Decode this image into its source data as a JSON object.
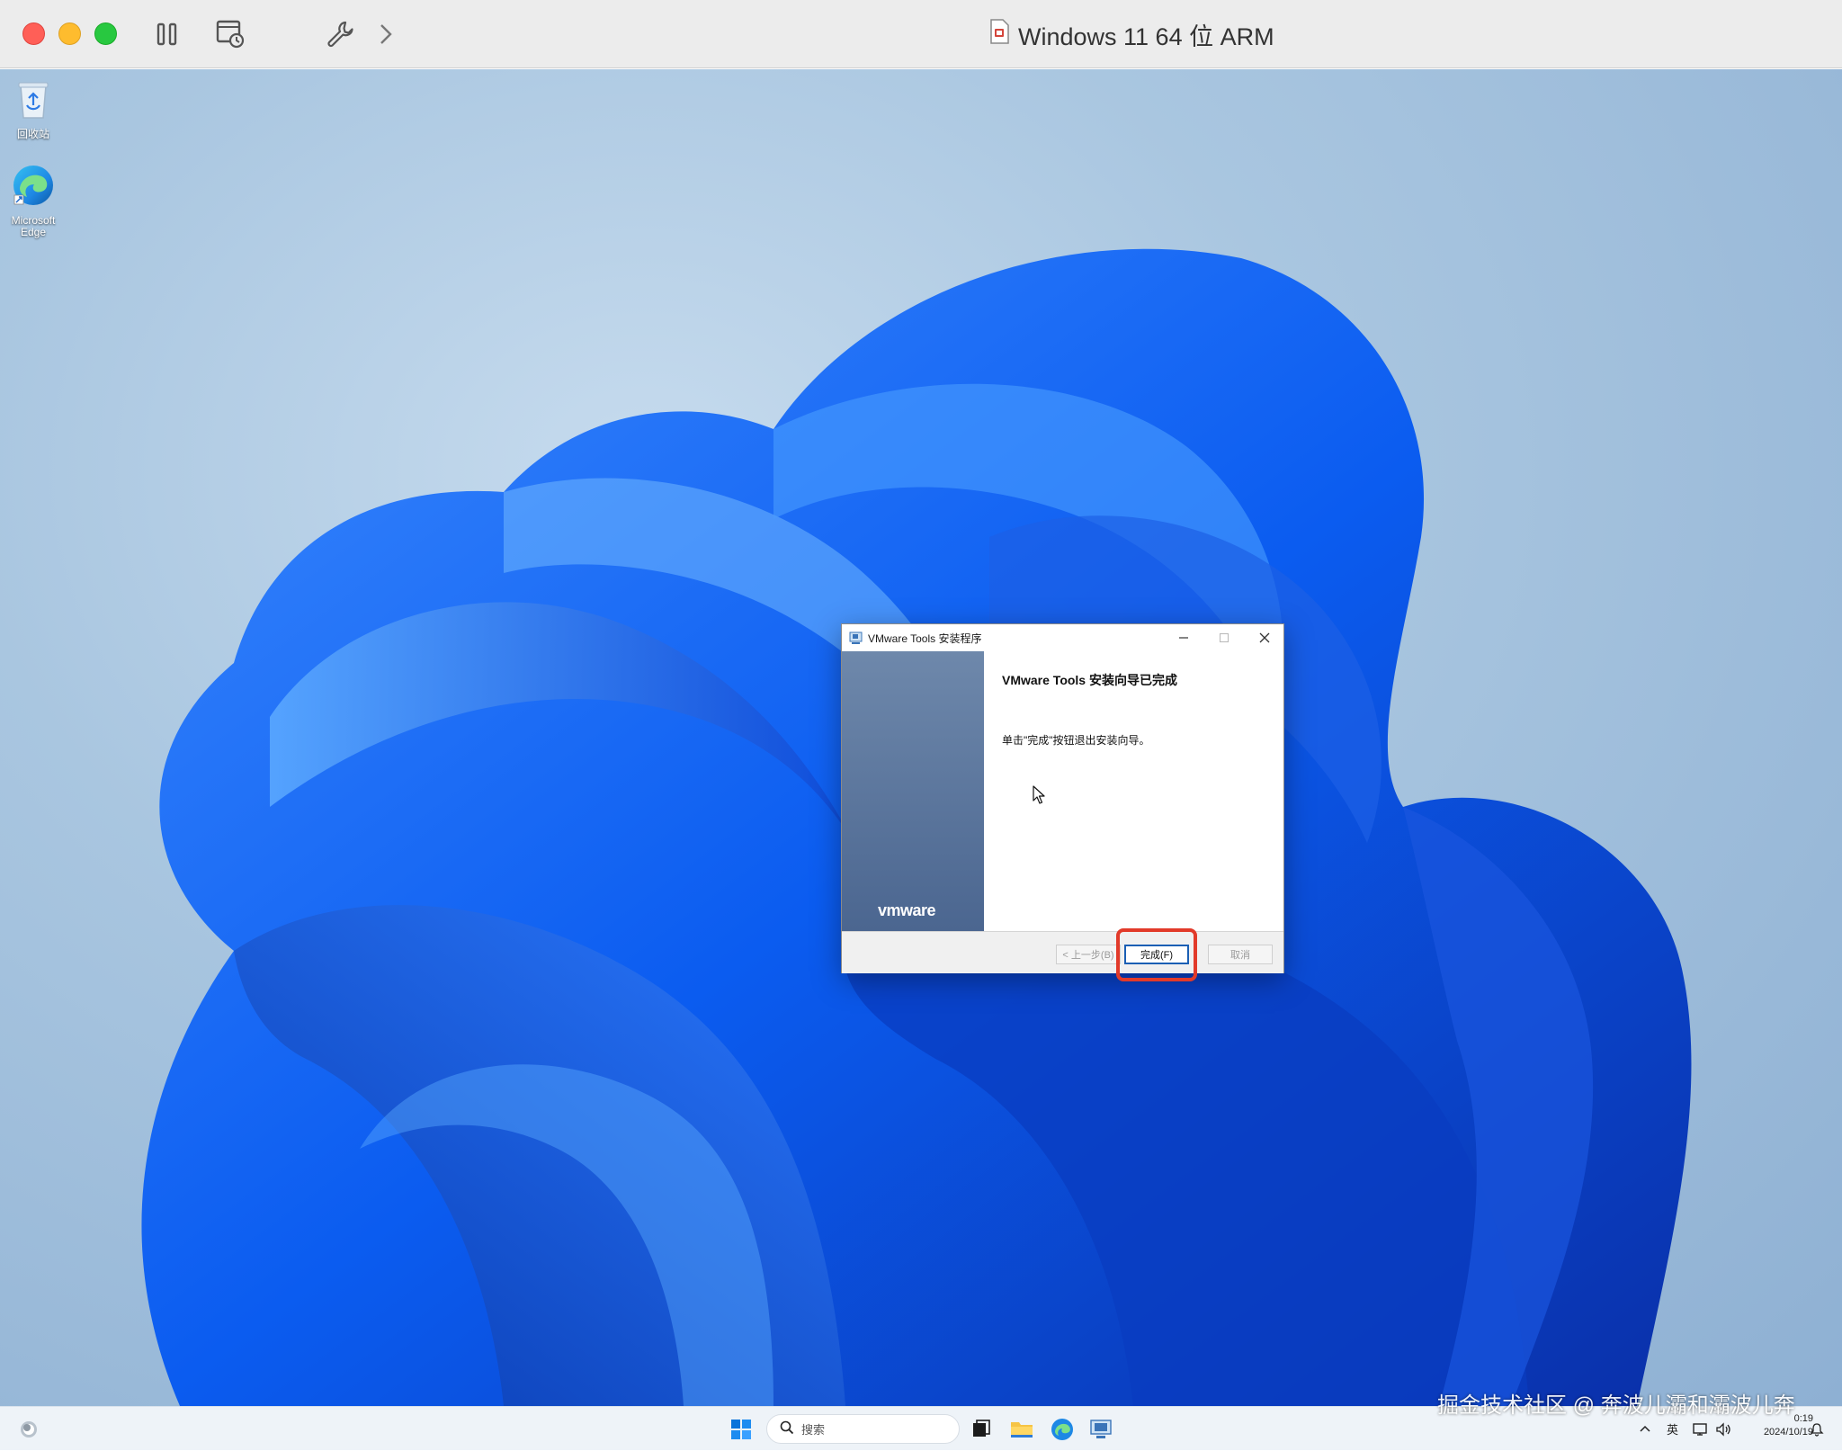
{
  "vm_window": {
    "title": "Windows 11 64 位 ARM"
  },
  "desktop": {
    "icons": [
      {
        "label": "回收站",
        "icon": "recycle-bin-icon"
      },
      {
        "label": "Microsoft Edge",
        "icon": "edge-icon"
      }
    ]
  },
  "dialog": {
    "title": "VMware Tools 安装程序",
    "heading": "VMware Tools 安装向导已完成",
    "body": "单击\"完成\"按钮退出安装向导。",
    "logo": "vmware",
    "buttons": {
      "back": "< 上一步(B)",
      "finish": "完成(F)",
      "cancel": "取消"
    }
  },
  "taskbar": {
    "search_placeholder": "搜索",
    "tray": {
      "ime": "英"
    },
    "clock": {
      "time": "0:19",
      "date": "2024/10/19"
    }
  },
  "watermark": "掘金技术社区 @ 奔波儿灞和灞波儿奔",
  "colors": {
    "accent": "#1a5fb4",
    "highlight": "#e23a2a",
    "dialog_side": "#5a76a0"
  }
}
